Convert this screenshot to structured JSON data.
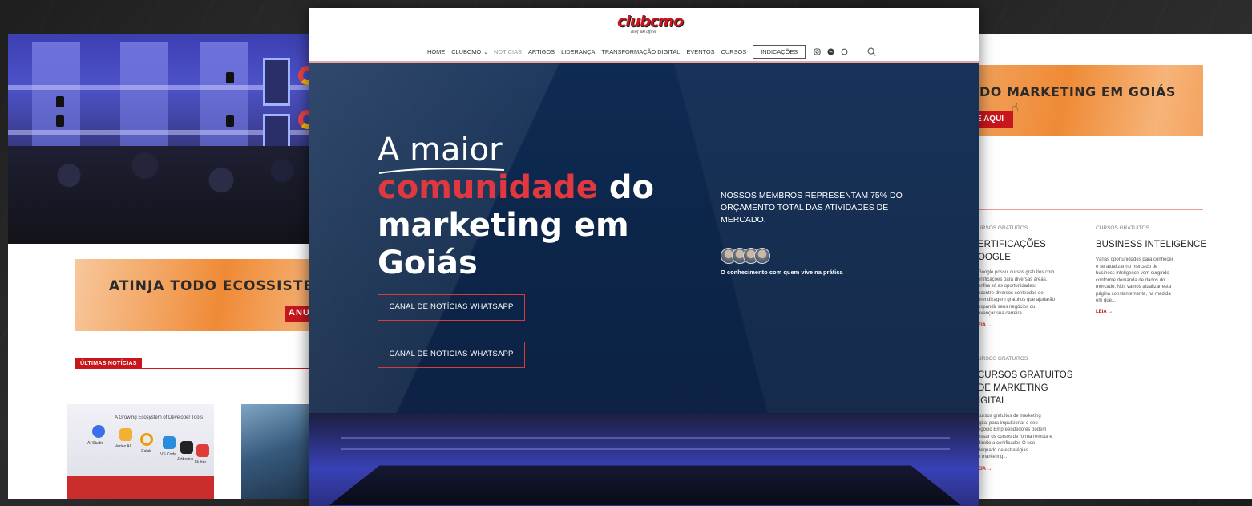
{
  "left": {
    "banner": {
      "text": "ATINJA TODO ECOSSISTEM",
      "button": "ANU"
    },
    "section_tag": "ÚLTIMAS NOTÍCIAS",
    "card": {
      "heading": "A Growing Ecosystem of Developer Tools",
      "items": [
        "AI Studio",
        "Vertex AI",
        "Colab",
        "VS Code",
        "Jetbrains",
        "Flutter"
      ]
    }
  },
  "nav": {
    "logo": "clubcmo",
    "logo_sub": "chief mkt officer",
    "items": [
      "HOME",
      "CLUBCMO",
      "NOTÍCIAS",
      "ARTIGOS",
      "LIDERANÇA",
      "TRANSFORMAÇÃO DIGITAL",
      "EVENTOS",
      "CURSOS"
    ],
    "button": "INDICAÇÕES",
    "icons": [
      "instagram-icon",
      "spotify-icon",
      "whatsapp-icon",
      "search-icon"
    ],
    "active_item": "NOTÍCIAS"
  },
  "hero": {
    "headline": {
      "line1": "A maior",
      "red": "comunidade",
      "rest1": " do",
      "line3": "marketing em",
      "line4": "Goiás"
    },
    "cta1": "CANAL DE NOTÍCIAS WHATSAPP",
    "cta2": "CANAL DE NOTÍCIAS WHATSAPP",
    "stat": "NOSSOS MEMBROS REPRESENTAM 75% DO ORÇAMENTO TOTAL DAS ATIVIDADES DE MERCADO.",
    "caption": "O conhecimento com quem vive na prática"
  },
  "right": {
    "banner": {
      "text": "DO MARKETING EM GOIÁS",
      "button": "E AQUI"
    },
    "posts": [
      {
        "cat": "URSOS GRATUITOS",
        "title_l1": "ERTIFICAÇÕES",
        "title_l2": "OOGLE",
        "text": [
          "Google possui cursos gratuitos com",
          "ertificações para diversas áreas.",
          "onfira só as oportunidades:",
          "ncontre diversos conteúdos de",
          "prendizagem gratuitos que ajudarão",
          "expandir seus negócios ou",
          "avançar sua carreira...."
        ],
        "link": "EIA →"
      },
      {
        "cat": "CURSOS GRATUITOS",
        "title_l1": "BUSINESS INTELIGENCE",
        "title_l2": "",
        "text": [
          "Várias oportunidades para conhecer",
          "e se atualizar no mercado de",
          "business inteligence vem surgindo",
          "conforme demanda de dados do",
          "mercado. Nós vamos atualizar esta",
          "página constantemente, na medida",
          "em que..."
        ],
        "link": "LEIA →"
      },
      {
        "cat": "URSOS GRATUITOS",
        "title_l1": " CURSOS GRATUITOS",
        "title_l2": "DE MARKETING",
        "title_l3": "IGITAL",
        "text": [
          "cursos gratuitos de marketing",
          "igital para impulsionar o seu",
          "egócio Empreendedores podem",
          "essar os cursos de forma remota e",
          "direito a certificados O uso",
          "dequado de estratégias",
          "e marketing..."
        ],
        "link": "EIA →"
      }
    ]
  },
  "colors": {
    "accent": "#c8161d",
    "hero_bg": "#0e2b54",
    "banner_orange": "#ef8a36"
  }
}
